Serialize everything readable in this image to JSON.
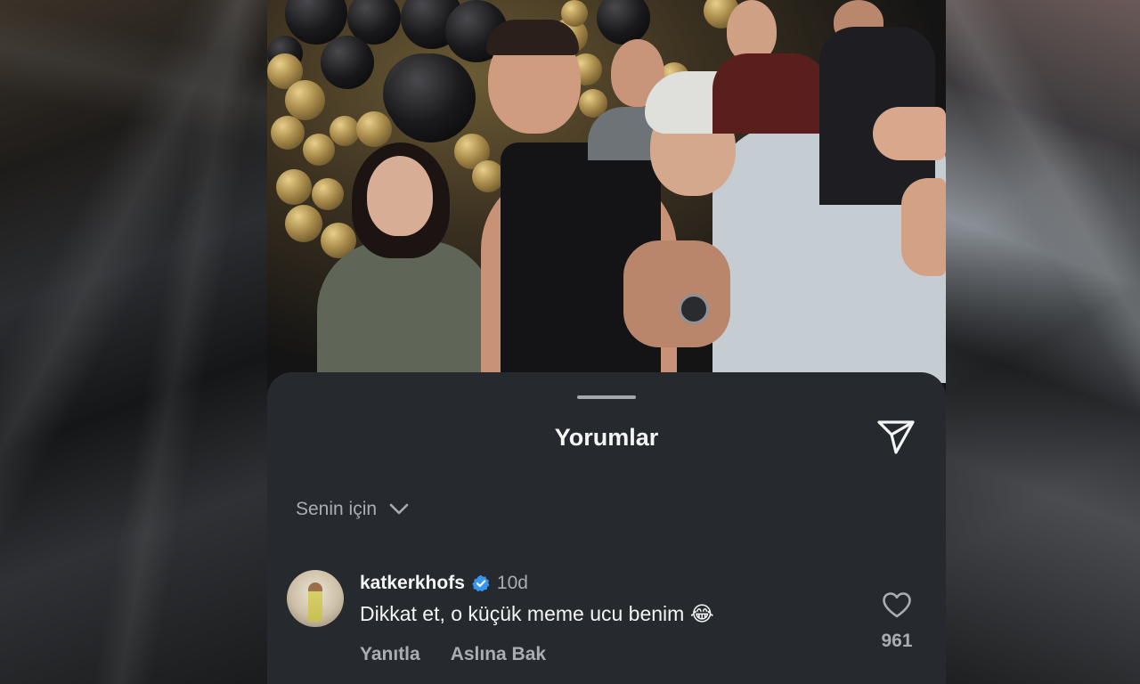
{
  "sheet": {
    "title": "Yorumlar",
    "share_icon": "send-icon"
  },
  "filter": {
    "label": "Senin için",
    "icon": "chevron-down-icon"
  },
  "comment": {
    "username": "katkerkhofs",
    "verified": true,
    "time": "10d",
    "text": "Dikkat et, o küçük meme ucu benim 😂",
    "reply_label": "Yanıtla",
    "translate_label": "Aslına Bak",
    "like_count": "961",
    "like_icon": "heart-icon"
  },
  "colors": {
    "sheet_bg": "#262a2f",
    "primary_text": "#f3f5f7",
    "secondary_text": "#a9aeb4",
    "verified_blue": "#3797f0"
  }
}
